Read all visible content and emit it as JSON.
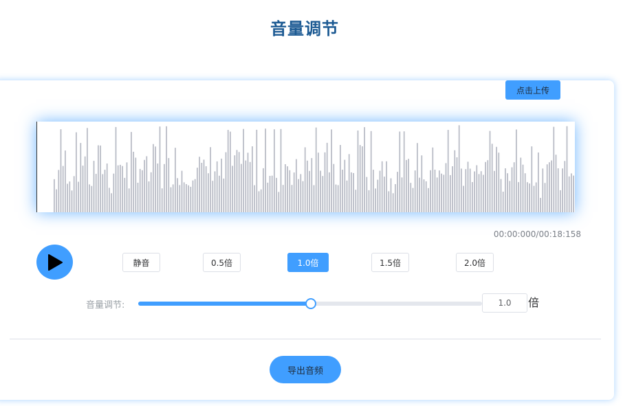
{
  "header": {
    "title": "音量调节"
  },
  "upload": {
    "label": "点击上传"
  },
  "player": {
    "time": "00:00:000/00:18:158",
    "play_icon": "play-icon"
  },
  "rates": [
    {
      "label": "静音",
      "active": false
    },
    {
      "label": "0.5倍",
      "active": false
    },
    {
      "label": "1.0倍",
      "active": true
    },
    {
      "label": "1.5倍",
      "active": false
    },
    {
      "label": "2.0倍",
      "active": false
    }
  ],
  "volume": {
    "label": "音量调节:",
    "value": "1.0",
    "unit": "倍",
    "slider_fraction": 0.5
  },
  "export": {
    "label": "导出音频"
  },
  "colors": {
    "accent": "#409eff",
    "title": "#1c5a93",
    "waveform": "#b9bcc6"
  }
}
